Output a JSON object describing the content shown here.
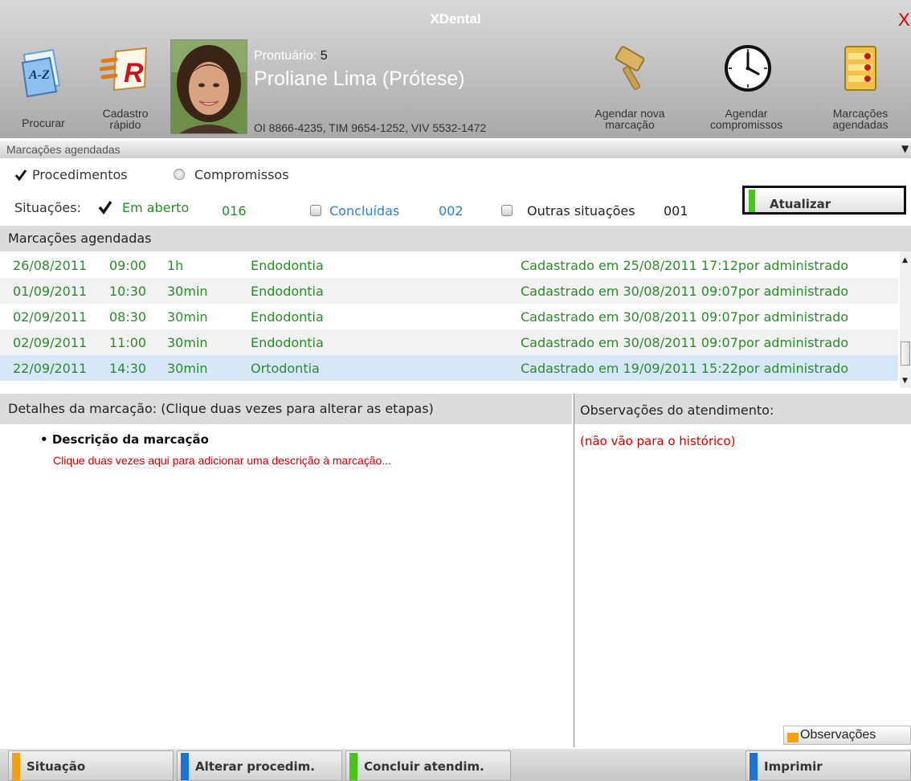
{
  "window": {
    "title": "XDental",
    "close_glyph": "X"
  },
  "toolbar": {
    "search_label": "Procurar",
    "quick_register_line1": "Cadastro",
    "quick_register_line2": "rápido",
    "new_appointment_line1": "Agendar nova",
    "new_appointment_line2": "marcação",
    "schedule_line1": "Agendar",
    "schedule_line2": "compromissos",
    "scheduled_line1": "Marcações",
    "scheduled_line2": "agendadas"
  },
  "patient": {
    "record_label": "Prontuário:",
    "record_number": "5",
    "name": "Proliane Lima (Prótese)",
    "phones": "OI 8866-4235, TIM 9654-1252, VIV 5532-1472"
  },
  "section_bar": {
    "label": "Marcações agendadas"
  },
  "filters": {
    "procedures_label": "Procedimentos",
    "commitments_label": "Compromissos",
    "situations_label": "Situações:",
    "open_label": "Em aberto",
    "open_count": "016",
    "done_label": "Concluídas",
    "done_count": "002",
    "other_label": "Outras situações",
    "other_count": "001"
  },
  "refresh_button": {
    "label": "Atualizar"
  },
  "list": {
    "header": "Marcações agendadas",
    "rows": [
      {
        "date": "26/08/2011",
        "time": "09:00",
        "duration": "1h",
        "procedure": "Endodontia",
        "info": "Cadastrado em 25/08/2011 17:12por administrado"
      },
      {
        "date": "01/09/2011",
        "time": "10:30",
        "duration": "30min",
        "procedure": "Endodontia",
        "info": "Cadastrado em 30/08/2011 09:07por administrado"
      },
      {
        "date": "02/09/2011",
        "time": "08:30",
        "duration": "30min",
        "procedure": "Endodontia",
        "info": "Cadastrado em 30/08/2011 09:07por administrado"
      },
      {
        "date": "02/09/2011",
        "time": "11:00",
        "duration": "30min",
        "procedure": "Endodontia",
        "info": "Cadastrado em 30/08/2011 09:07por administrado"
      },
      {
        "date": "22/09/2011",
        "time": "14:30",
        "duration": "30min",
        "procedure": "Ortodontia",
        "info": "Cadastrado em 19/09/2011 15:22por administrado"
      }
    ]
  },
  "details": {
    "header": "Detalhes da marcação: (Clique duas vezes para alterar as etapas)",
    "bullet": "•",
    "desc_title": "Descrição da marcação",
    "desc_text": "Clique duas vezes aqui para adicionar uma descrição à marcação..."
  },
  "observations": {
    "header": "Observações do atendimento:",
    "note": "(não vão para o histórico)",
    "button": "Observações"
  },
  "bottom_buttons": {
    "status": "Situação",
    "change": "Alterar procedim.",
    "finish": "Concluir atendim.",
    "print": "Imprimir"
  },
  "colors": {
    "accent_green": "#48c51d",
    "accent_blue": "#1a73d8",
    "accent_orange": "#f4a20c",
    "text_green": "#2b8b2b",
    "text_red": "#d40000",
    "link_blue": "#2f7fd0"
  }
}
